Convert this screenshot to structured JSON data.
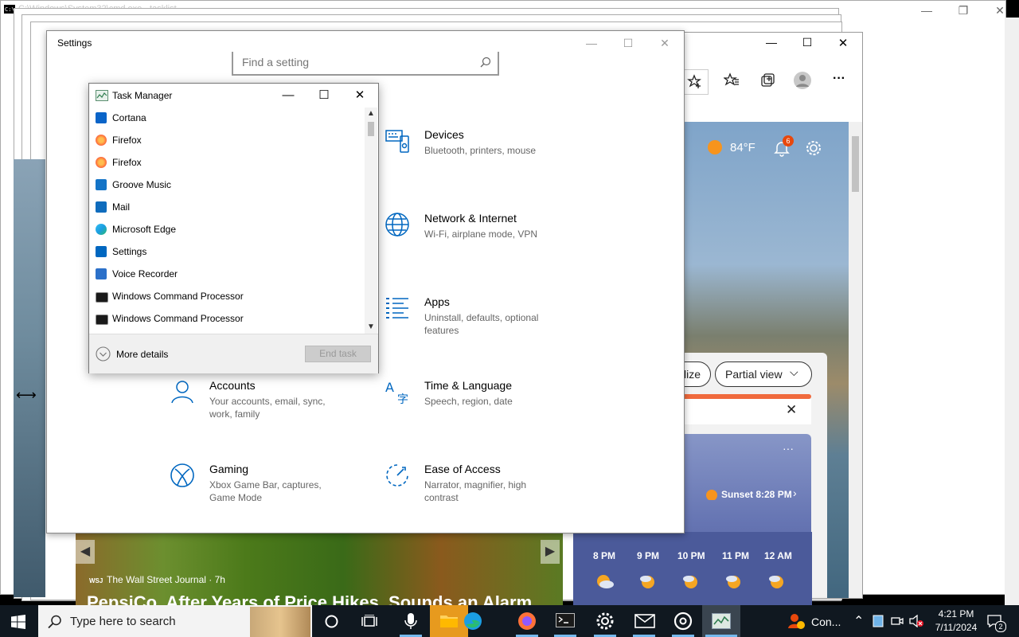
{
  "cmd": {
    "title_text": "C:\\Windows\\System32\\cmd.exe - tasklist"
  },
  "settings": {
    "title": "Settings",
    "search_placeholder": "Find a setting",
    "tiles": [
      {
        "title": "Devices",
        "desc": "Bluetooth, printers, mouse"
      },
      {
        "title": "Network & Internet",
        "desc": "Wi-Fi, airplane mode, VPN"
      },
      {
        "title": "Apps",
        "desc": "Uninstall, defaults, optional features"
      },
      {
        "title": "Accounts",
        "desc": "Your accounts, email, sync, work, family"
      },
      {
        "title": "Time & Language",
        "desc": "Speech, region, date"
      },
      {
        "title": "Gaming",
        "desc": "Xbox Game Bar, captures, Game Mode"
      },
      {
        "title": "Ease of Access",
        "desc": "Narrator, magnifier, high contrast"
      }
    ]
  },
  "task_manager": {
    "title": "Task Manager",
    "apps": [
      {
        "label": "Cortana",
        "color": "#0a64c8"
      },
      {
        "label": "Firefox",
        "color": "#ff7139"
      },
      {
        "label": "Firefox",
        "color": "#ff7139"
      },
      {
        "label": "Groove Music",
        "color": "#1474c7"
      },
      {
        "label": "Mail",
        "color": "#0f6cbd"
      },
      {
        "label": "Microsoft Edge",
        "color": "#1b9de2"
      },
      {
        "label": "Settings",
        "color": "#0067c0"
      },
      {
        "label": "Voice Recorder",
        "color": "#2b70c9"
      },
      {
        "label": "Windows Command Processor",
        "color": "#1a1a1a"
      },
      {
        "label": "Windows Command Processor",
        "color": "#1a1a1a"
      }
    ],
    "more_details": "More details",
    "end_task": "End task"
  },
  "edge": {
    "temperature": "84°F",
    "notifications": "6",
    "partial_view": "Partial view",
    "customize_partial": "lize",
    "sunset": "Sunset 8:28 PM",
    "hours": [
      "8 PM",
      "9 PM",
      "10 PM",
      "11 PM",
      "12 AM"
    ],
    "news_source": "The Wall Street Journal · 7h",
    "news_source_badge": "WSJ",
    "news_headline": "PepsiCo, After Years of Price Hikes, Sounds an Alarm"
  },
  "taskbar": {
    "search_placeholder": "Type here to search",
    "time": "4:21 PM",
    "date": "7/11/2024",
    "connect_label": "Con...",
    "notification_count": "2"
  },
  "colors": {
    "accent": "#0067c0",
    "taskbar": "#101820"
  }
}
